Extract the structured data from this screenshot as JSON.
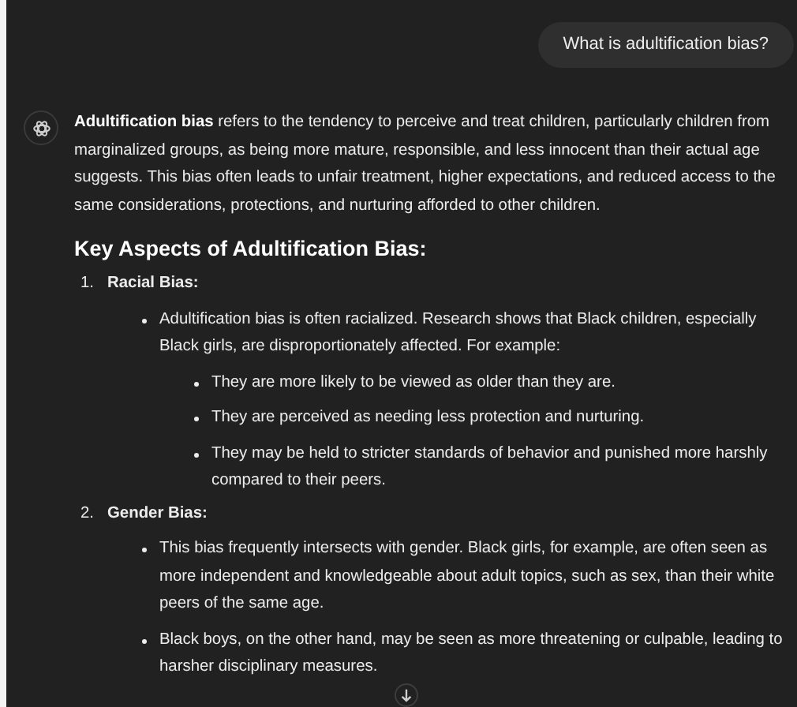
{
  "user_message": {
    "text": "What is adultification bias?"
  },
  "response": {
    "intro": "**Adultification bias** refers to the tendency to perceive and treat children, particularly children from marginalized groups, as being more mature, responsible, and less innocent than their actual age suggests. This bias often leads to unfair treatment, higher expectations, and reduced access to the same considerations, protections, and nurturing afforded to other children.",
    "heading": "Key Aspects of Adultification Bias:",
    "sections": [
      {
        "number": "1.",
        "title": "**Racial Bias**:",
        "bullets": [
          {
            "text": "Adultification bias is often racialized. Research shows that Black children, especially Black girls, are disproportionately affected. For example:",
            "children": [
              {
                "text": "They are more likely to be viewed as older than they are."
              },
              {
                "text": "They are perceived as needing less protection and nurturing."
              },
              {
                "text": "They may be held to stricter standards of behavior and punished more harshly compared to their peers."
              }
            ]
          }
        ]
      },
      {
        "number": "2.",
        "title": "**Gender Bias:**",
        "bullets": [
          {
            "text": "This bias frequently intersects with gender. Black girls, for example, are often seen as more independent and knowledgeable about adult topics, such as sex, than their white peers of the same age."
          },
          {
            "text": "Black boys, on the other hand, may be seen as more threatening or culpable, leading to harsher disciplinary measures."
          }
        ]
      }
    ]
  }
}
